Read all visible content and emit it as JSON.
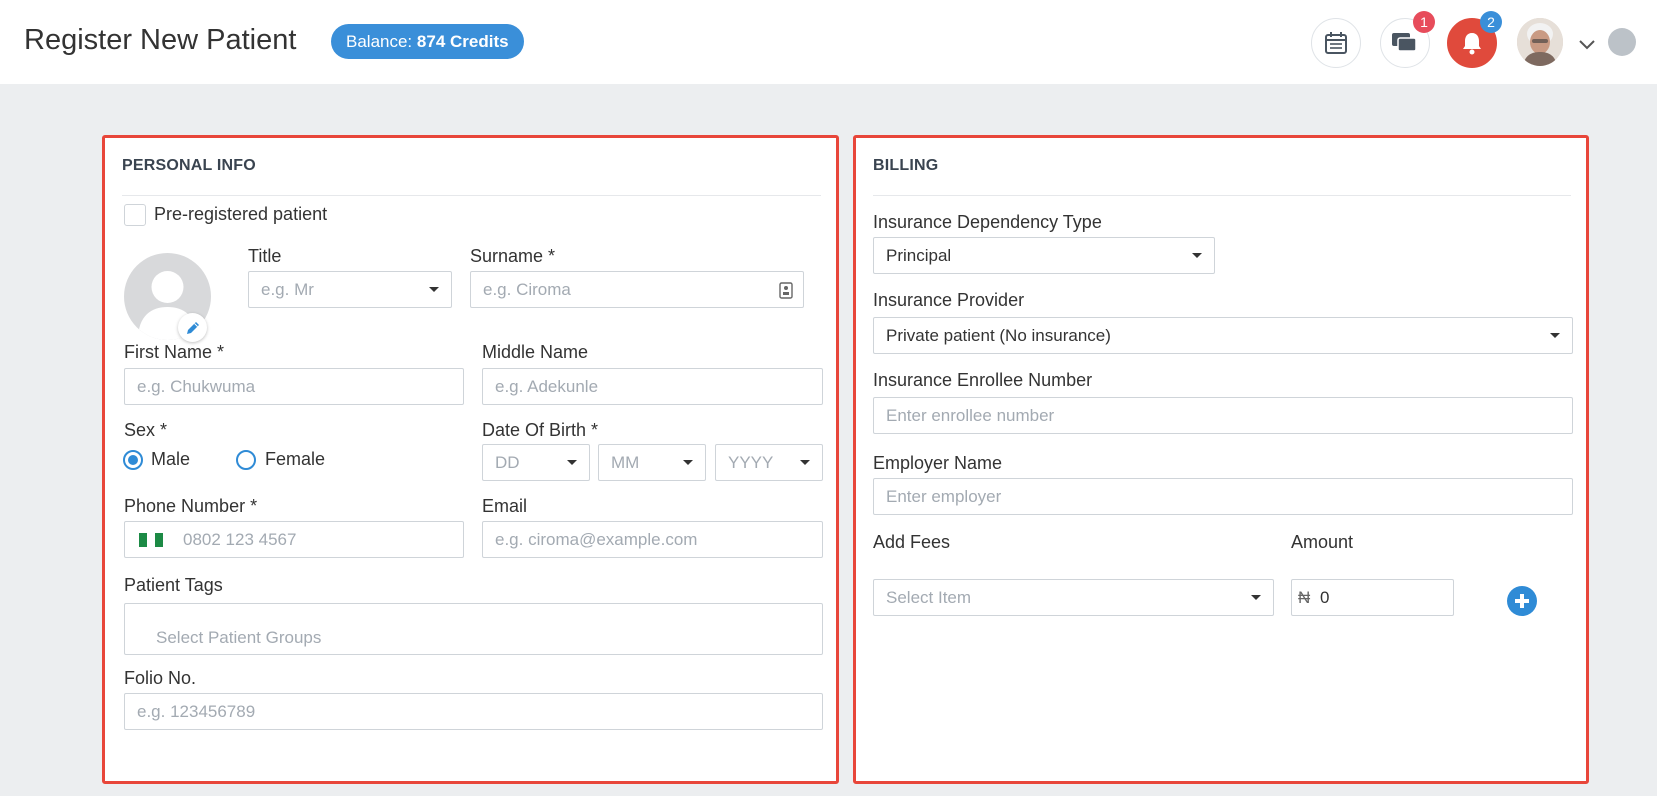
{
  "header": {
    "title": "Register New Patient",
    "balance_prefix": "Balance:",
    "balance_value": "874 Credits",
    "messages_count": "1",
    "notifications_count": "2"
  },
  "colors": {
    "accent": "#3a8fd9",
    "notification_red": "#e04a3c",
    "panel_border": "#e8463a"
  },
  "icons": {
    "calendar": "calendar-icon",
    "messages": "chat-bubbles-icon",
    "notifications": "bell-icon",
    "user_menu": "chevron-down-icon",
    "photo_edit": "pencil-icon",
    "surname_lookup": "contact-card-icon",
    "add_fee": "plus-circle-icon"
  },
  "personal_info": {
    "title": "PERSONAL INFO",
    "pre_registered_label": "Pre-registered patient",
    "title_label": "Title",
    "title_placeholder": "e.g. Mr",
    "surname_label": "Surname *",
    "surname_placeholder": "e.g. Ciroma",
    "first_name_label": "First Name *",
    "first_name_placeholder": "e.g. Chukwuma",
    "middle_name_label": "Middle Name",
    "middle_name_placeholder": "e.g. Adekunle",
    "sex_label": "Sex *",
    "sex_options": [
      "Male",
      "Female"
    ],
    "sex_selected": "Male",
    "dob_label": "Date Of Birth *",
    "dob_day": "DD",
    "dob_month": "MM",
    "dob_year": "YYYY",
    "phone_label": "Phone Number *",
    "phone_placeholder": "0802 123 4567",
    "email_label": "Email",
    "email_placeholder": "e.g. ciroma@example.com",
    "tags_label": "Patient Tags",
    "tags_placeholder": "Select Patient Groups",
    "folio_label": "Folio No.",
    "folio_placeholder": "e.g. 123456789"
  },
  "billing": {
    "title": "BILLING",
    "dependency_label": "Insurance Dependency Type",
    "dependency_value": "Principal",
    "provider_label": "Insurance Provider",
    "provider_value": "Private patient (No insurance)",
    "enrollee_label": "Insurance Enrollee Number",
    "enrollee_placeholder": "Enter enrollee number",
    "employer_label": "Employer Name",
    "employer_placeholder": "Enter employer",
    "fees_label": "Add Fees",
    "fees_placeholder": "Select Item",
    "amount_label": "Amount",
    "currency_symbol": "₦",
    "amount_value": "0"
  }
}
